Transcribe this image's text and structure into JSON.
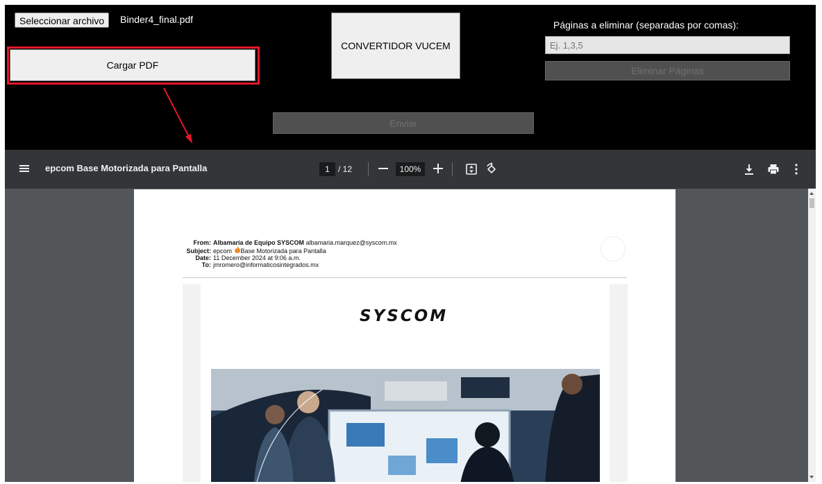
{
  "top_panel": {
    "file_button_label": "Seleccionar archivo",
    "file_name": "Binder4_final.pdf",
    "load_button_label": "Cargar PDF",
    "converter_button_label": "CONVERTIDOR VUCEM",
    "pages_label": "Páginas a eliminar (separadas por comas):",
    "pages_placeholder": "Ej. 1,3,5",
    "delete_button_label": "Eliminar Páginas",
    "send_button_label": "Enviar"
  },
  "annotation": {
    "highlight_color": "#e2182a"
  },
  "pdf_viewer": {
    "title": "epcom Base Motorizada para Pantalla",
    "current_page": "1",
    "total_pages": "/ 12",
    "zoom": "100%",
    "toolbar_color": "#323639",
    "background_color": "#525659",
    "icons": [
      "menu-icon",
      "zoom-out-icon",
      "zoom-in-icon",
      "fit-page-icon",
      "rotate-icon",
      "download-icon",
      "print-icon",
      "more-options-icon"
    ]
  },
  "document": {
    "from_label": "From:",
    "from_sender": "Albamaría de Equipo SYSCOM",
    "from_email": "albamaria.marquez@syscom.mx",
    "subject_label": "Subject:",
    "subject_prefix": "epcom",
    "subject_rest": "Base Motorizada para Pantalla",
    "date_label": "Date:",
    "date_value": "11 December 2024 at 9:06 a.m.",
    "to_label": "To:",
    "to_value": "jmromero@informaticosintegrados.mx",
    "brand": "SYSCOM"
  }
}
